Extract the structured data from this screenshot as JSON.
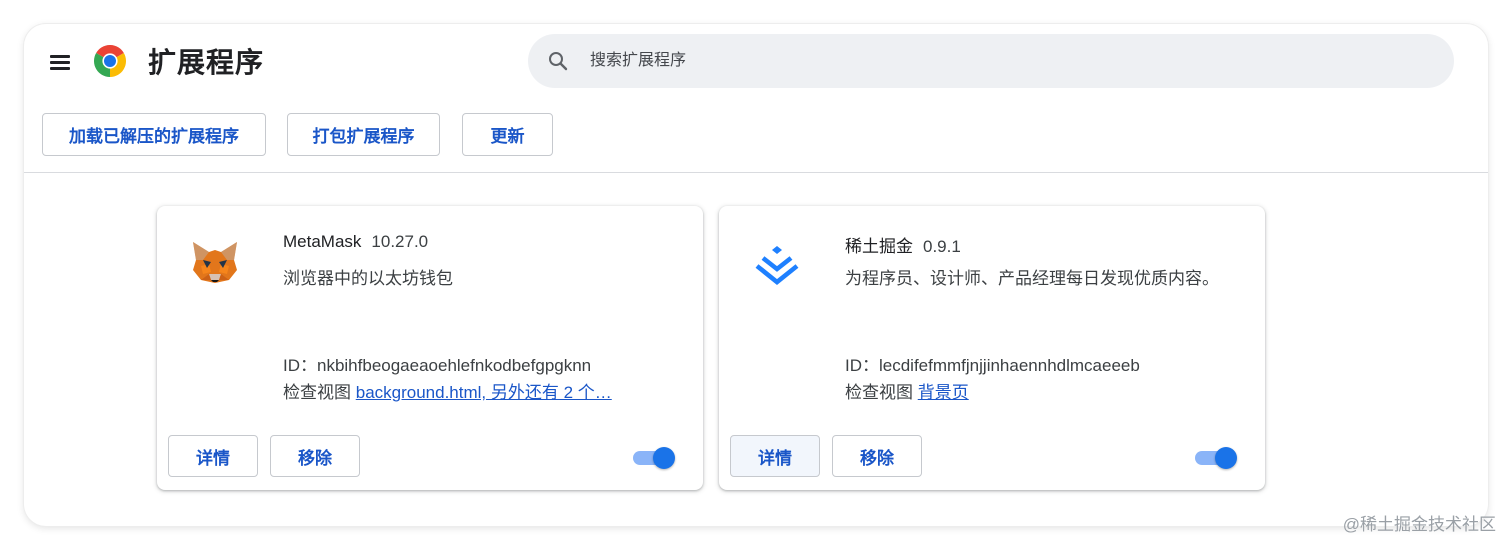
{
  "header": {
    "title": "扩展程序",
    "search_placeholder": "搜索扩展程序"
  },
  "toolbar": {
    "load_unpacked_label": "加载已解压的扩展程序",
    "pack_label": "打包扩展程序",
    "update_label": "更新"
  },
  "extensions": [
    {
      "name": "MetaMask",
      "version": "10.27.0",
      "description": "浏览器中的以太坊钱包",
      "id_text": "ID：nkbihfbeogaeaoehlefnkodbefgpgknn",
      "inspect_label": "检查视图",
      "inspect_link": "background.html, 另外还有 2 个…",
      "details_label": "详情",
      "remove_label": "移除",
      "enabled": true,
      "icon": "metamask-fox-icon"
    },
    {
      "name": "稀土掘金",
      "version": "0.9.1",
      "description": "为程序员、设计师、产品经理每日发现优质内容。",
      "id_text": "ID：lecdifefmmfjnjjinhaennhdlmcaeeeb",
      "inspect_label": "检查视图",
      "inspect_link": "背景页",
      "details_label": "详情",
      "remove_label": "移除",
      "enabled": true,
      "icon": "juejin-logo-icon"
    }
  ],
  "watermark": "@稀土掘金技术社区",
  "colors": {
    "accent": "#1a56c8",
    "toggle_on": "#1a73e8",
    "search_bg": "#eef0f3"
  }
}
